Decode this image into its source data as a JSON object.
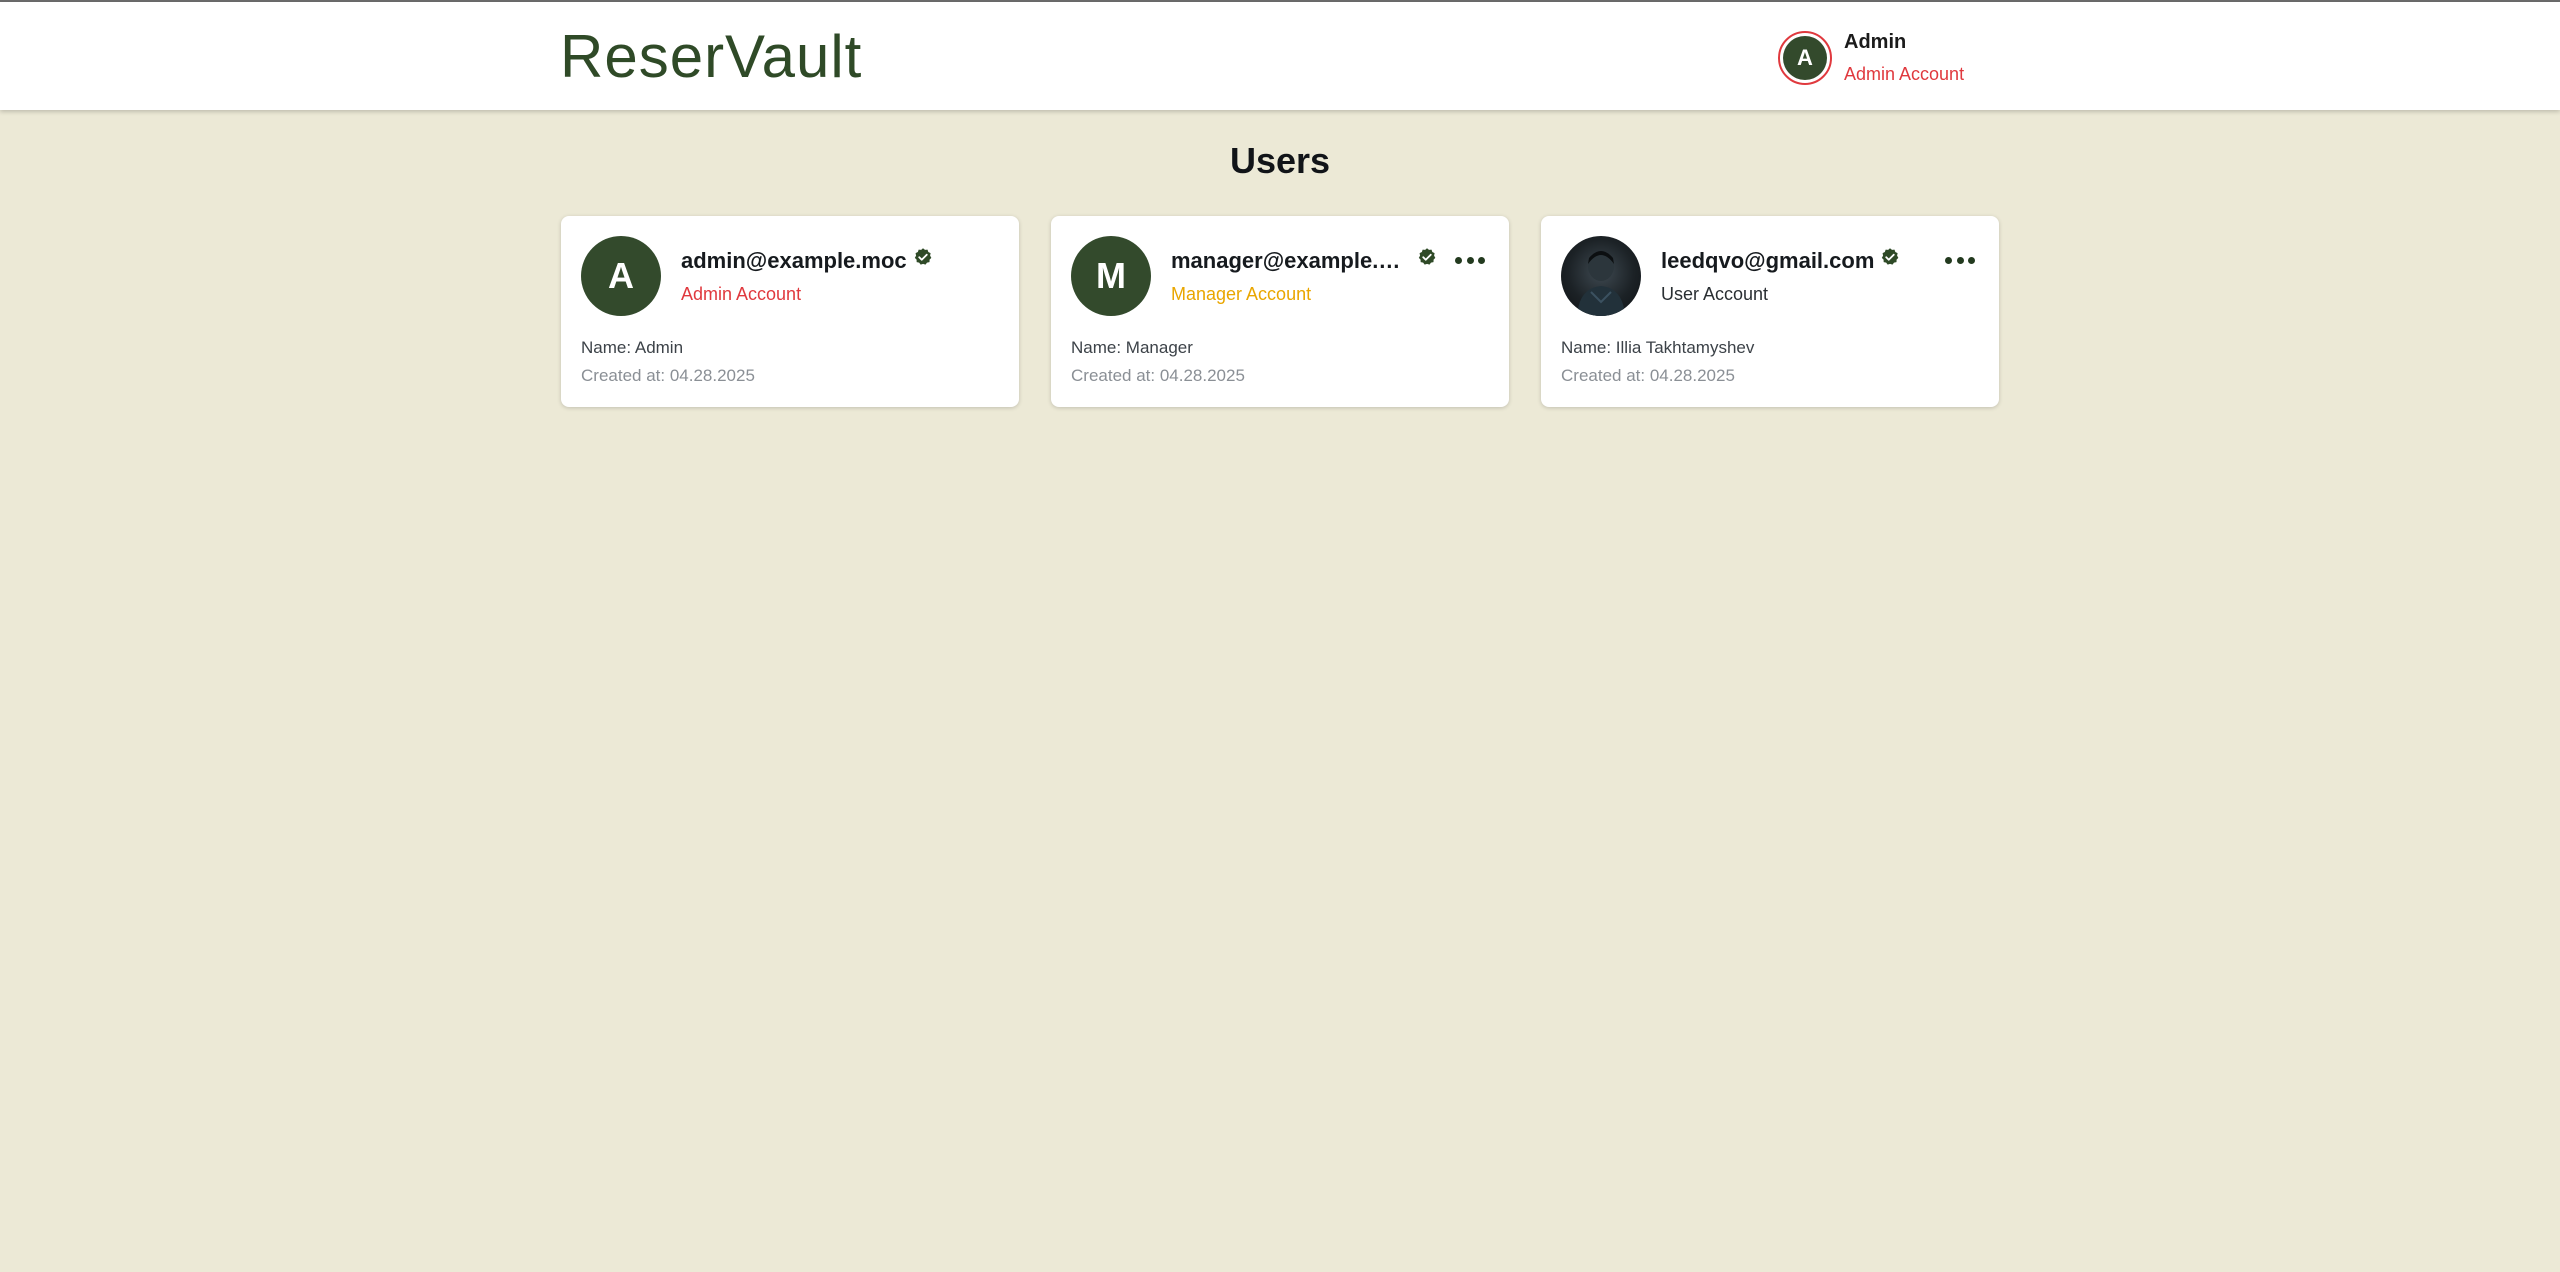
{
  "app": {
    "brand": "ReserVault"
  },
  "header": {
    "account": {
      "avatar_initial": "A",
      "name": "Admin",
      "role": "Admin Account"
    }
  },
  "page": {
    "title": "Users"
  },
  "users": [
    {
      "avatar_initial": "A",
      "email": "admin@example.moc",
      "role": "Admin Account",
      "role_color": "#e0393e",
      "verified": true,
      "has_menu": false,
      "name_line": "Name: Admin",
      "created_line": "Created at: 04.28.2025"
    },
    {
      "avatar_initial": "M",
      "email": "manager@example.m...",
      "role": "Manager Account",
      "role_color": "#e9a600",
      "verified": true,
      "has_menu": true,
      "name_line": "Name: Manager",
      "created_line": "Created at: 04.28.2025"
    },
    {
      "avatar_initial": "",
      "avatar_type": "photo",
      "email": "leedqvo@gmail.com",
      "role": "User Account",
      "role_color": "#2a2f33",
      "verified": true,
      "has_menu": true,
      "name_line": "Name: Illia Takhtamyshev",
      "created_line": "Created at: 04.28.2025"
    }
  ],
  "icons": {
    "verified": "verified-badge-icon",
    "more": "more-horizontal-icon"
  },
  "colors": {
    "brand": "#2f4a27",
    "avatar_bg": "#334a2c",
    "background": "#ece9d6",
    "admin_role": "#e0393e",
    "manager_role": "#e9a600"
  }
}
